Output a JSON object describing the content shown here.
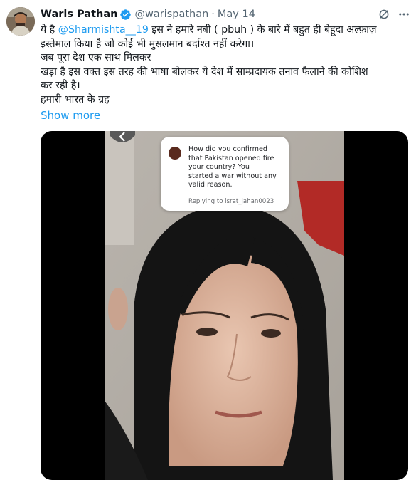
{
  "tweet": {
    "author_name": "Waris Pathan",
    "author_handle": "@warispathan",
    "separator": "·",
    "date": "May 14",
    "text_lines": [
      {
        "before": "ये है ",
        "mention": "@Sharmishta__19",
        "after": " इस ने हमारे नबी ( pbuh ) के बारे में बहुत ही बेहूदा अल्फ़ाज़"
      },
      {
        "before": "इस्तेमाल किया है  जो कोई भी मुसलमान बर्दाश्त नहीं करेगा।",
        "mention": "",
        "after": ""
      },
      {
        "before": "जब पूरा देश एक साथ मिलकर",
        "mention": "",
        "after": ""
      },
      {
        "before": "खड़ा है इस वक्त इस तरह की भाषा बोलकर ये देश में साम्प्रदायक तनाव फैलाने की कोशिश",
        "mention": "",
        "after": ""
      },
      {
        "before": "कर रही है।",
        "mention": "",
        "after": ""
      },
      {
        "before": "हमारी भारत के ग्रह",
        "mention": "",
        "after": ""
      }
    ],
    "show_more": "Show more"
  },
  "media": {
    "question_box": {
      "lines": [
        "How did you confirmed",
        "that Pakistan opened fire",
        "your country?  You",
        "started a war without any",
        "valid reason."
      ],
      "reply": "Replying to israt_jahan0023"
    }
  },
  "icons": {
    "verified": "verified-badge-icon",
    "grok": "grok-icon",
    "more": "more-options-icon",
    "back": "back-arrow-icon"
  },
  "colors": {
    "accent": "#1d9bf0",
    "text": "#0f1419",
    "secondary": "#536471",
    "media_bg": "#000000"
  }
}
